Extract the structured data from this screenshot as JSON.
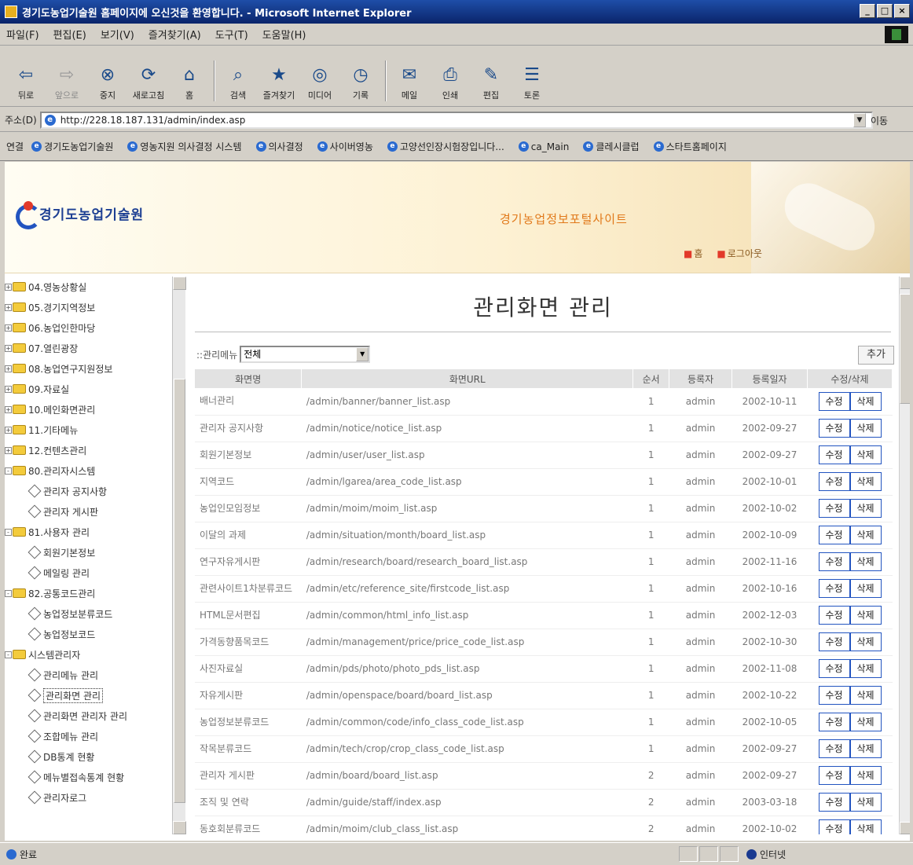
{
  "window": {
    "title": "경기도농업기술원 홈페이지에 오신것을 환영합니다. - Microsoft Internet Explorer",
    "controls": [
      "_",
      "□",
      "×"
    ]
  },
  "menu": [
    "파일(F)",
    "편집(E)",
    "보기(V)",
    "즐겨찾기(A)",
    "도구(T)",
    "도움말(H)"
  ],
  "toolbar": [
    {
      "label": "뒤로",
      "icon": "back-arrow-icon",
      "glyph": "⇦"
    },
    {
      "label": "앞으로",
      "icon": "forward-arrow-icon",
      "glyph": "⇨"
    },
    {
      "label": "중지",
      "icon": "stop-icon",
      "glyph": "⊗"
    },
    {
      "label": "새로고침",
      "icon": "refresh-icon",
      "glyph": "⟳"
    },
    {
      "label": "홈",
      "icon": "home-icon",
      "glyph": "⌂"
    },
    {
      "label": "검색",
      "icon": "search-icon",
      "glyph": "⌕"
    },
    {
      "label": "즐겨찾기",
      "icon": "favorites-icon",
      "glyph": "★"
    },
    {
      "label": "미디어",
      "icon": "media-icon",
      "glyph": "◎"
    },
    {
      "label": "기록",
      "icon": "history-icon",
      "glyph": "◷"
    },
    {
      "label": "메일",
      "icon": "mail-icon",
      "glyph": "✉"
    },
    {
      "label": "인쇄",
      "icon": "print-icon",
      "glyph": "⎙"
    },
    {
      "label": "편집",
      "icon": "edit-icon",
      "glyph": "✎"
    },
    {
      "label": "토론",
      "icon": "discuss-icon",
      "glyph": "☰"
    }
  ],
  "address": {
    "label": "주소(D)",
    "url": "http://228.18.187.131/admin/index.asp",
    "go": "이동"
  },
  "links": {
    "label": "연결",
    "items": [
      "경기도농업기술원",
      "영농지원 의사결정 시스템",
      "의사결정",
      "사이버영농",
      "고양선인장시험장입니다...",
      "ca_Main",
      "클레시클럽",
      "스타트홈페이지"
    ]
  },
  "banner": {
    "logo_text": "경기도농업기술원",
    "site_title": "경기농업정보포털사이트",
    "nav": [
      "홈",
      "로그아웃"
    ]
  },
  "tree": [
    {
      "label": "04.영농상황실",
      "level": 0,
      "toggle": "+"
    },
    {
      "label": "05.경기지역정보",
      "level": 0,
      "toggle": "+"
    },
    {
      "label": "06.농업인한마당",
      "level": 0,
      "toggle": "+"
    },
    {
      "label": "07.열린광장",
      "level": 0,
      "toggle": "+"
    },
    {
      "label": "08.농업연구지원정보",
      "level": 0,
      "toggle": "+"
    },
    {
      "label": "09.자료실",
      "level": 0,
      "toggle": "+"
    },
    {
      "label": "10.메인화면관리",
      "level": 0,
      "toggle": "+"
    },
    {
      "label": "11.기타메뉴",
      "level": 0,
      "toggle": "+"
    },
    {
      "label": "12.컨텐츠관리",
      "level": 0,
      "toggle": "+"
    },
    {
      "label": "80.관리자시스템",
      "level": 0,
      "toggle": "-"
    },
    {
      "label": "관리자 공지사항",
      "level": 1
    },
    {
      "label": "관리자 게시판",
      "level": 1
    },
    {
      "label": "81.사용자 관리",
      "level": 0,
      "toggle": "-"
    },
    {
      "label": "회원기본정보",
      "level": 1
    },
    {
      "label": "메일링 관리",
      "level": 1
    },
    {
      "label": "82.공통코드관리",
      "level": 0,
      "toggle": "-"
    },
    {
      "label": "농업정보분류코드",
      "level": 1
    },
    {
      "label": "농업정보코드",
      "level": 1
    },
    {
      "label": "시스템관리자",
      "level": 0,
      "toggle": "-"
    },
    {
      "label": "관리메뉴 관리",
      "level": 1
    },
    {
      "label": "관리화면 관리",
      "level": 1,
      "selected": true
    },
    {
      "label": "관리화면 관리자 관리",
      "level": 1
    },
    {
      "label": "조합메뉴 관리",
      "level": 1
    },
    {
      "label": "DB통계 현황",
      "level": 1
    },
    {
      "label": "메뉴별접속통계 현황",
      "level": 1
    },
    {
      "label": "관리자로그",
      "level": 1
    }
  ],
  "main": {
    "title": "관리화면 관리",
    "filter_label": "::관리메뉴",
    "filter_value": "전체",
    "add_label": "추가",
    "columns": [
      "화면명",
      "화면URL",
      "순서",
      "등록자",
      "등록일자",
      "수정/삭제"
    ],
    "edit_label": "수정",
    "delete_label": "삭제",
    "rows": [
      {
        "name": "배너관리",
        "url": "/admin/banner/banner_list.asp",
        "order": "1",
        "registrant": "admin",
        "date": "2002-10-11"
      },
      {
        "name": "관리자 공지사항",
        "url": "/admin/notice/notice_list.asp",
        "order": "1",
        "registrant": "admin",
        "date": "2002-09-27"
      },
      {
        "name": "회원기본정보",
        "url": "/admin/user/user_list.asp",
        "order": "1",
        "registrant": "admin",
        "date": "2002-09-27"
      },
      {
        "name": "지역코드",
        "url": "/admin/lgarea/area_code_list.asp",
        "order": "1",
        "registrant": "admin",
        "date": "2002-10-01"
      },
      {
        "name": "농업인모임정보",
        "url": "/admin/moim/moim_list.asp",
        "order": "1",
        "registrant": "admin",
        "date": "2002-10-02"
      },
      {
        "name": "이달의 과제",
        "url": "/admin/situation/month/board_list.asp",
        "order": "1",
        "registrant": "admin",
        "date": "2002-10-09"
      },
      {
        "name": "연구자유게시판",
        "url": "/admin/research/board/research_board_list.asp",
        "order": "1",
        "registrant": "admin",
        "date": "2002-11-16"
      },
      {
        "name": "관련사이트1차분류코드",
        "url": "/admin/etc/reference_site/firstcode_list.asp",
        "order": "1",
        "registrant": "admin",
        "date": "2002-10-16"
      },
      {
        "name": "HTML문서편집",
        "url": "/admin/common/html_info_list.asp",
        "order": "1",
        "registrant": "admin",
        "date": "2002-12-03"
      },
      {
        "name": "가격동향품목코드",
        "url": "/admin/management/price/price_code_list.asp",
        "order": "1",
        "registrant": "admin",
        "date": "2002-10-30"
      },
      {
        "name": "사진자료실",
        "url": "/admin/pds/photo/photo_pds_list.asp",
        "order": "1",
        "registrant": "admin",
        "date": "2002-11-08"
      },
      {
        "name": "자유게시판",
        "url": "/admin/openspace/board/board_list.asp",
        "order": "1",
        "registrant": "admin",
        "date": "2002-10-22"
      },
      {
        "name": "농업정보분류코드",
        "url": "/admin/common/code/info_class_code_list.asp",
        "order": "1",
        "registrant": "admin",
        "date": "2002-10-05"
      },
      {
        "name": "작목분류코드",
        "url": "/admin/tech/crop/crop_class_code_list.asp",
        "order": "1",
        "registrant": "admin",
        "date": "2002-09-27"
      },
      {
        "name": "관리자 게시판",
        "url": "/admin/board/board_list.asp",
        "order": "2",
        "registrant": "admin",
        "date": "2002-09-27"
      },
      {
        "name": "조직 및 연락",
        "url": "/admin/guide/staff/index.asp",
        "order": "2",
        "registrant": "admin",
        "date": "2003-03-18"
      },
      {
        "name": "동호회분류코드",
        "url": "/admin/moim/club_class_list.asp",
        "order": "2",
        "registrant": "admin",
        "date": "2002-10-02"
      }
    ]
  },
  "status": {
    "text": "완료",
    "zone": "인터넷"
  }
}
